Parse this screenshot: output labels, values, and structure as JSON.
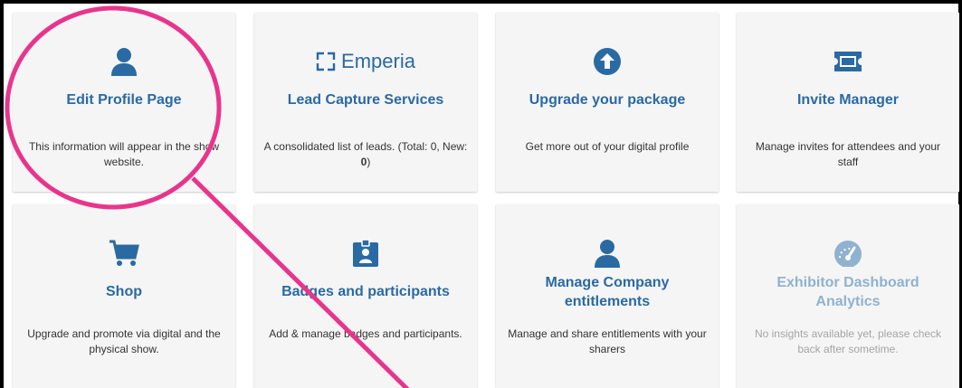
{
  "accent_color": "#2a6aa3",
  "cards": [
    {
      "title": "Edit Profile Page",
      "description": "This information will appear in the show website.",
      "icon": "user-icon"
    },
    {
      "logo_text": "Emperia",
      "title": "Lead Capture Services",
      "description_prefix": "A consolidated list of leads. (Total: 0, New: ",
      "description_bold": "0",
      "description_suffix": ")",
      "icon": "emperia-logo"
    },
    {
      "title": "Upgrade your package",
      "description": "Get more out of your digital profile",
      "icon": "arrow-up-circle-icon"
    },
    {
      "title": "Invite Manager",
      "description": "Manage invites for attendees and your staff",
      "icon": "ticket-icon"
    },
    {
      "title": "Shop",
      "description": "Upgrade and promote via digital and the physical show.",
      "icon": "shopping-cart-icon"
    },
    {
      "title": "Badges and participants",
      "description": "Add & manage badges and participants.",
      "icon": "badge-icon"
    },
    {
      "title": "Manage Company entitlements",
      "description": "Manage and share entitlements with your sharers",
      "icon": "user-icon"
    },
    {
      "title": "Exhibitor Dashboard Analytics",
      "description": "No insights available yet, please check back after sometime.",
      "icon": "speedometer-icon"
    }
  ],
  "annotation_color": "#e8358c"
}
